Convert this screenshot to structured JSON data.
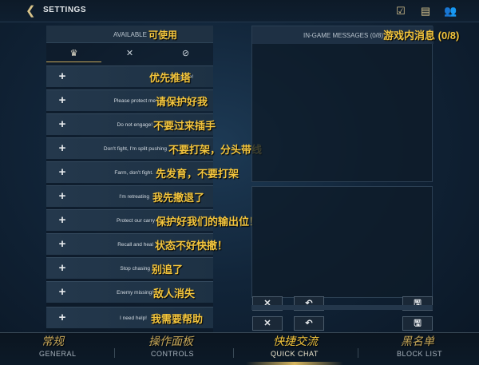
{
  "topbar": {
    "title": "SETTINGS",
    "icons": [
      "checklist-icon",
      "chat-icon",
      "friends-icon"
    ]
  },
  "available": {
    "label": "AVAILABLE",
    "label_cn": "可使用",
    "tabs": [
      {
        "name": "tab-allow",
        "glyph": "♛"
      },
      {
        "name": "tab-deny",
        "glyph": "✕"
      },
      {
        "name": "tab-hidden",
        "glyph": "⊘"
      }
    ],
    "items": [
      {
        "en": "Let's push!",
        "cn": "优先推塔"
      },
      {
        "en": "Please protect me",
        "cn": "请保护好我"
      },
      {
        "en": "Do not engage!",
        "cn": "不要过来插手"
      },
      {
        "en": "Don't fight, I'm split pushing",
        "cn": "不要打架，分头带线"
      },
      {
        "en": "Farm, don't fight.",
        "cn": "先发育，不要打架"
      },
      {
        "en": "I'm retreating",
        "cn": "我先撤退了"
      },
      {
        "en": "Protect our carry",
        "cn": "保护好我们的输出位！"
      },
      {
        "en": "Recall and heal",
        "cn": "状态不好快撤！"
      },
      {
        "en": "Stop chasing",
        "cn": "别追了"
      },
      {
        "en": "Enemy missing!",
        "cn": "敌人消失"
      },
      {
        "en": "I need help!",
        "cn": "我需要帮助"
      }
    ],
    "plus": "+"
  },
  "messages": {
    "label": "IN-GAME MESSAGES (0/8)",
    "label_cn": "游戏内消息 (0/8)"
  },
  "actions": {
    "clear": "✕",
    "undo": "↶",
    "save": "🖫"
  },
  "nav": [
    {
      "cn": "常规",
      "en": "GENERAL"
    },
    {
      "cn": "操作面板",
      "en": "CONTROLS"
    },
    {
      "cn": "快捷交流",
      "en": "QUICK CHAT"
    },
    {
      "cn": "黑名单",
      "en": "BLOCK LIST"
    }
  ],
  "colors": {
    "accent": "#f3c53d",
    "gold": "#c7a85a",
    "panel": "#1e3044"
  }
}
